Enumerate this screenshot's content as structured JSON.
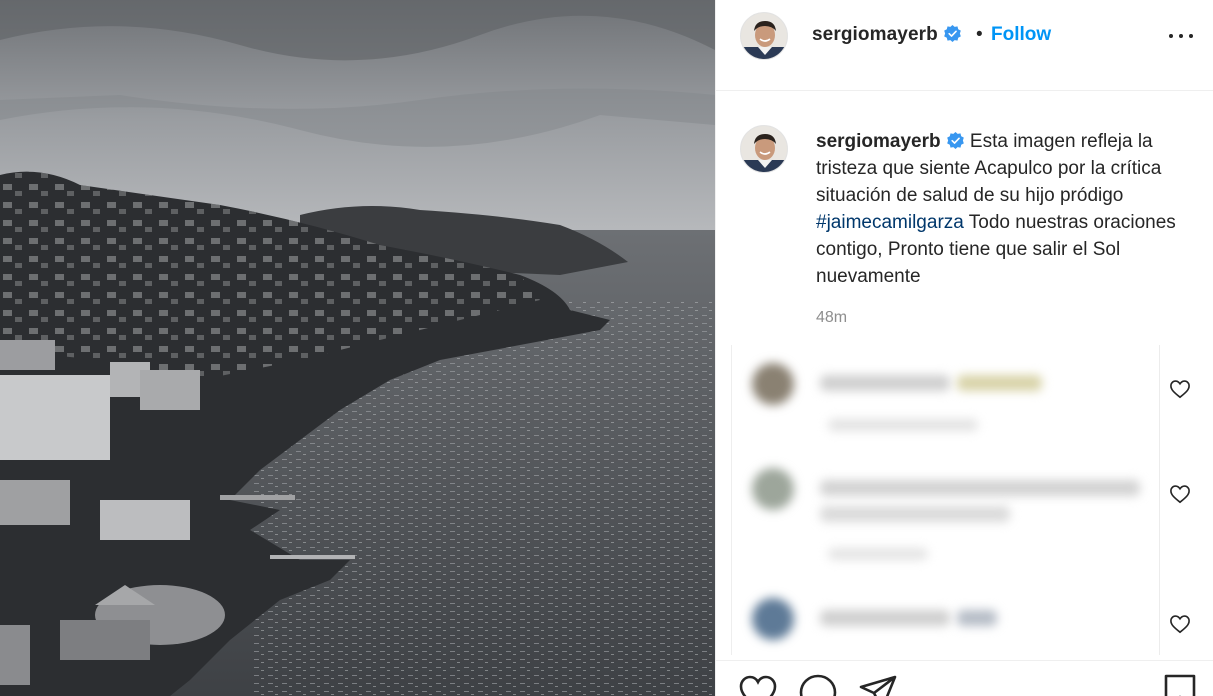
{
  "post": {
    "author": {
      "username": "sergiomayerb",
      "verified": true,
      "avatar_icon": "profile-photo"
    },
    "header": {
      "separator": "•",
      "follow_label": "Follow",
      "more_icon": "more-options-icon"
    },
    "caption": {
      "username": "sergiomayerb",
      "text_before": "Esta imagen refleja la tristeza que siente Acapulco por la crítica situación de salud de su hijo pródigo ",
      "hashtag": "#jaimecamilgarza",
      "text_after": " Todo nuestras oraciones contigo, Pronto tiene que salir el Sol nuevamente",
      "time": "48m"
    },
    "comments_blurred": 3,
    "actions": [
      "like-icon",
      "comment-icon",
      "share-icon",
      "save-icon"
    ]
  },
  "colors": {
    "accent": "#0095f6",
    "hashtag": "#00376b",
    "verified": "#3897f0",
    "muted": "#8e8e8e"
  }
}
